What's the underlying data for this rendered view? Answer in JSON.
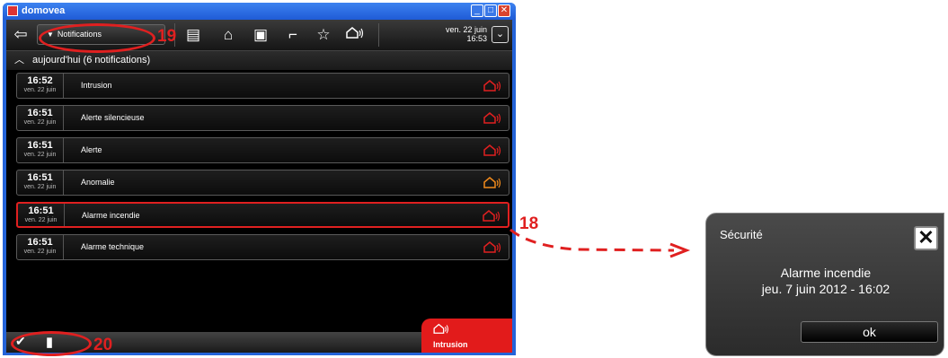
{
  "window": {
    "title": "domovea",
    "controls": [
      "minimize",
      "maximize",
      "close"
    ]
  },
  "toolbar": {
    "back_icon": "back-arrow-icon",
    "dropdown_label": "Notifications",
    "icons": [
      "list-icon",
      "home-icon",
      "scene-icon",
      "camera-icon",
      "favorite-icon",
      "alarm-icon"
    ],
    "date": "ven. 22 juin",
    "time": "16:53"
  },
  "section": {
    "title": "aujourd'hui (6 notifications)"
  },
  "notifications": [
    {
      "time": "16:52",
      "date": "ven. 22 juin",
      "label": "Intrusion",
      "color": "#e02020"
    },
    {
      "time": "16:51",
      "date": "ven. 22 juin",
      "label": "Alerte silencieuse",
      "color": "#e02020"
    },
    {
      "time": "16:51",
      "date": "ven. 22 juin",
      "label": "Alerte",
      "color": "#e02020"
    },
    {
      "time": "16:51",
      "date": "ven. 22 juin",
      "label": "Anomalie",
      "color": "#f08a1c"
    },
    {
      "time": "16:51",
      "date": "ven. 22 juin",
      "label": "Alarme incendie",
      "color": "#e02020"
    },
    {
      "time": "16:51",
      "date": "ven. 22 juin",
      "label": "Alarme technique",
      "color": "#e02020"
    }
  ],
  "bottom": {
    "active_alarm": "Intrusion"
  },
  "callouts": {
    "n18": "18",
    "n19": "19",
    "n20": "20"
  },
  "dialog": {
    "title": "Sécurité",
    "message_line1": "Alarme incendie",
    "message_line2": "jeu. 7 juin 2012 - 16:02",
    "ok_label": "ok"
  },
  "colors": {
    "accent_red": "#e21b1b",
    "titlebar_blue": "#2463d8"
  }
}
